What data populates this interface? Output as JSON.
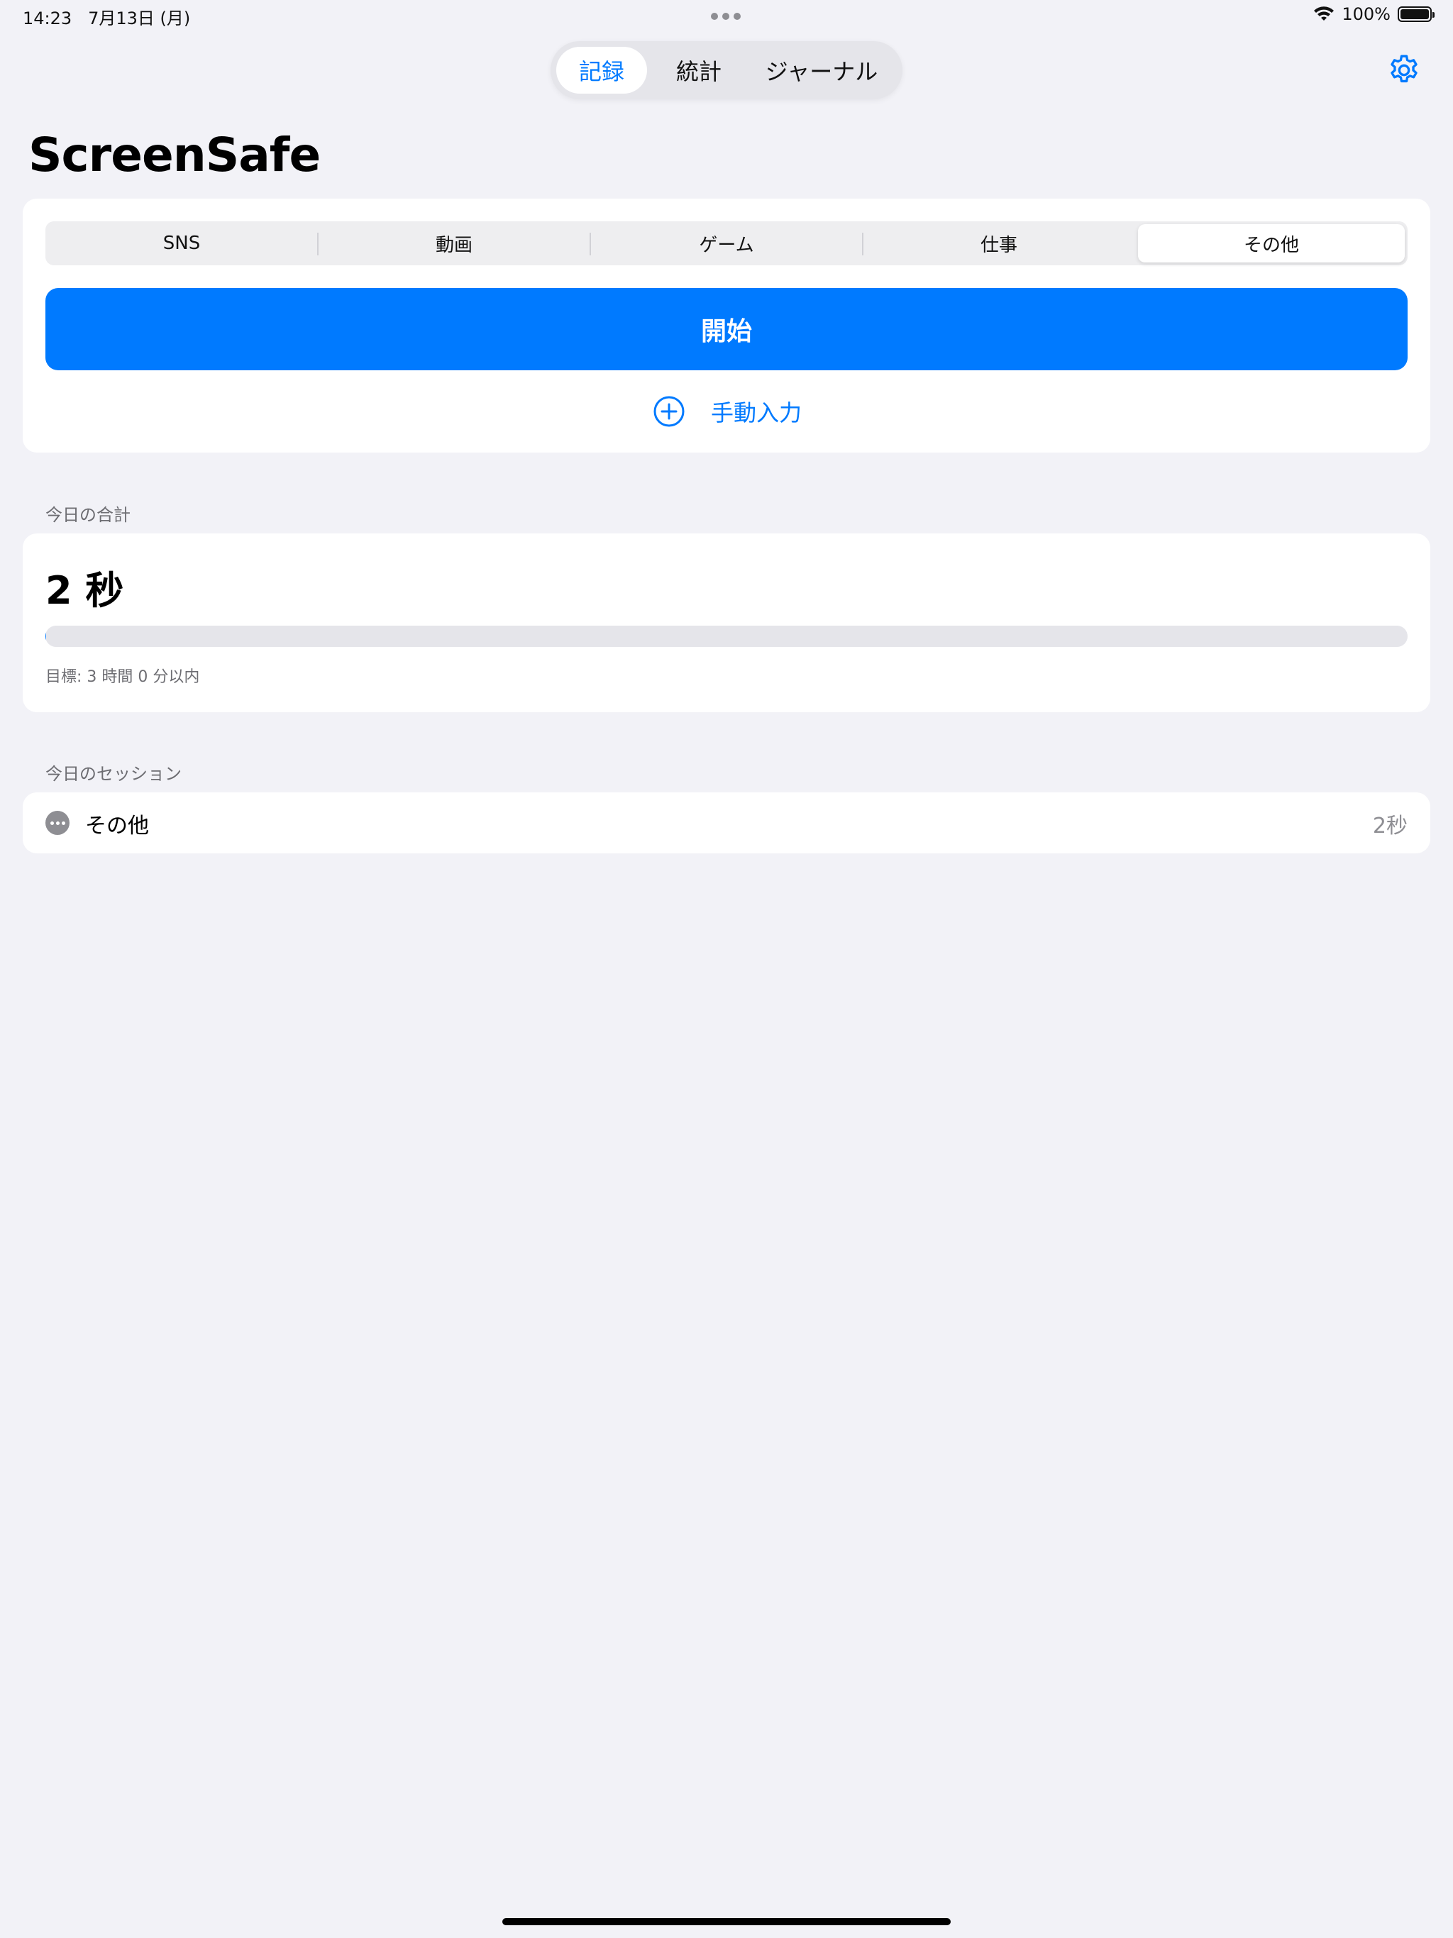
{
  "status_bar": {
    "time": "14:23",
    "date": "7月13日 (月)",
    "battery": "100%"
  },
  "top_tabs": [
    {
      "label": "記録",
      "active": true
    },
    {
      "label": "統計",
      "active": false
    },
    {
      "label": "ジャーナル",
      "active": false
    }
  ],
  "app_title": "ScreenSafe",
  "categories": [
    {
      "label": "SNS",
      "active": false
    },
    {
      "label": "動画",
      "active": false
    },
    {
      "label": "ゲーム",
      "active": false
    },
    {
      "label": "仕事",
      "active": false
    },
    {
      "label": "その他",
      "active": true
    }
  ],
  "start_label": "開始",
  "manual_label": "手動入力",
  "today_total": {
    "header": "今日の合計",
    "value": "2 秒",
    "progress": 0.0002,
    "goal": "目標: 3 時間 0 分以内"
  },
  "sessions": {
    "header": "今日のセッション",
    "items": [
      {
        "name": "その他",
        "duration": "2秒",
        "icon": "ellipsis-circle-icon"
      }
    ]
  },
  "colors": {
    "accent": "#007aff",
    "background": "#f2f2f7"
  }
}
